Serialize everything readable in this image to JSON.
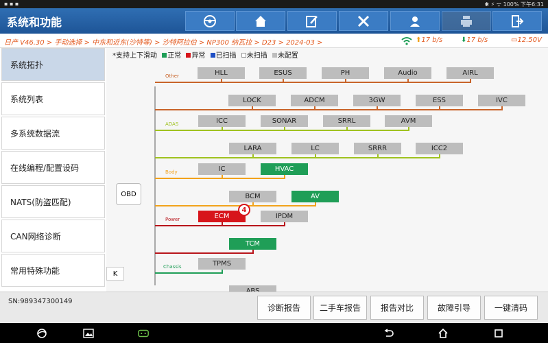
{
  "status": {
    "left": "▪ ▪ ▪",
    "right": "✱ ⚡ ᯤ 100% 下午6:31"
  },
  "title": "系统和功能",
  "toolbar": [
    {
      "icon": "steering-wheel-icon"
    },
    {
      "icon": "home-icon"
    },
    {
      "icon": "edit-icon"
    },
    {
      "icon": "tools-icon"
    },
    {
      "icon": "support-agent-icon"
    },
    {
      "icon": "printer-icon"
    },
    {
      "icon": "exit-icon"
    }
  ],
  "breadcrumb": "日产 V46.30 > 手动选择 > 中东和近东(沙特等) > 沙特阿拉伯 > NP300 纳瓦拉 > D23 > 2024-03 >",
  "rates": {
    "up": "17 b/s",
    "down": "17 b/s",
    "voltage": "12.50V"
  },
  "sidebar": [
    "系统拓扑",
    "系统列表",
    "多系统数据流",
    "在线编程/配置设码",
    "NATS(防盗匹配)",
    "CAN网络诊断",
    "常用特殊功能"
  ],
  "legend": {
    "hint": "*支持上下滑动",
    "normal": "正常",
    "abnormal": "异常",
    "scanned": "已扫描",
    "unscanned": "未扫描",
    "unconfigured": "未配置"
  },
  "topology": {
    "obd": "OBD",
    "groups": [
      {
        "name": "Other",
        "color": "#c8642a",
        "rows": [
          [
            "HLL",
            "ESUS",
            "PH",
            "Audio",
            "AIRL"
          ],
          [
            "LOCK",
            "ADCM",
            "3GW",
            "ESS",
            "IVC"
          ]
        ]
      },
      {
        "name": "ADAS",
        "color": "#9fc21f",
        "rows": [
          [
            "ICC",
            "SONAR",
            "SRRL",
            "AVM"
          ],
          [
            "LARA",
            "LC",
            "SRRR",
            "ICC2"
          ]
        ]
      },
      {
        "name": "Body",
        "color": "#f2a21b",
        "rows": [
          [
            "IC",
            "HVAC"
          ],
          [
            "BCM",
            "AV"
          ]
        ]
      },
      {
        "name": "Power",
        "color": "#b8141a",
        "rows": [
          [
            "ECM",
            "IPDM"
          ],
          [
            "TCM"
          ]
        ]
      },
      {
        "name": "Chassis",
        "color": "#1f9e57",
        "rows": [
          [
            "TPMS"
          ],
          [
            "ABS"
          ]
        ]
      }
    ],
    "status": {
      "HVAC": "normal",
      "AV": "normal",
      "TCM": "normal",
      "ECM": "abnormal"
    },
    "ecm_fault_count": "4",
    "colors": {
      "normal": "#1f9e57",
      "abnormal": "#d7151b",
      "scanned": "#1f4fc4",
      "unconfigured": "#bdbdbd"
    }
  },
  "serial": "SN:989347300149",
  "actions": [
    "诊断报告",
    "二手车报告",
    "报告对比",
    "故障引导",
    "一键清码"
  ],
  "collapse_label": "K"
}
